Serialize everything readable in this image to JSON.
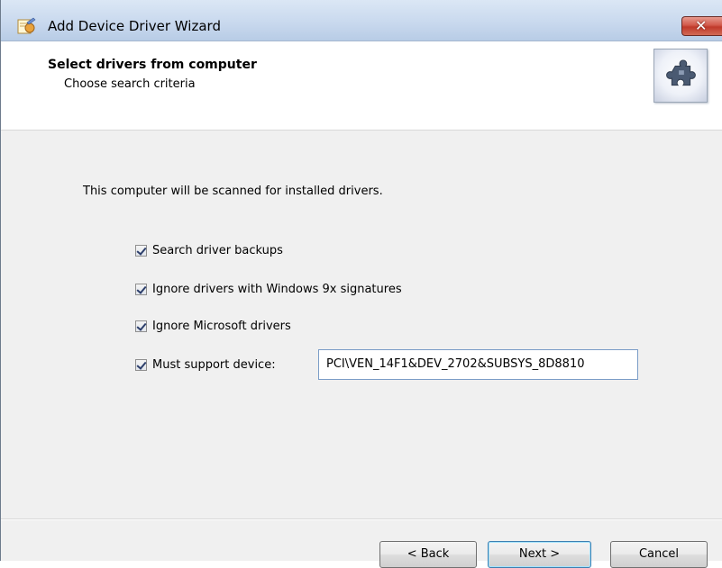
{
  "window": {
    "title": "Add Device Driver Wizard",
    "close_label": "x"
  },
  "header": {
    "title": "Select drivers from computer",
    "subtitle": "Choose search criteria",
    "icon": "gear-puzzle-icon"
  },
  "body": {
    "intro": "This computer will be scanned for installed drivers.",
    "options": [
      {
        "label": "Search driver backups",
        "checked": true
      },
      {
        "label": "Ignore drivers with Windows 9x signatures",
        "checked": true
      },
      {
        "label": "Ignore Microsoft drivers",
        "checked": true
      },
      {
        "label": "Must support device:",
        "checked": true
      }
    ],
    "device_value": "PCI\\VEN_14F1&DEV_2702&SUBSYS_8D8810"
  },
  "buttons": {
    "back": "< Back",
    "next": "Next >",
    "cancel": "Cancel"
  }
}
